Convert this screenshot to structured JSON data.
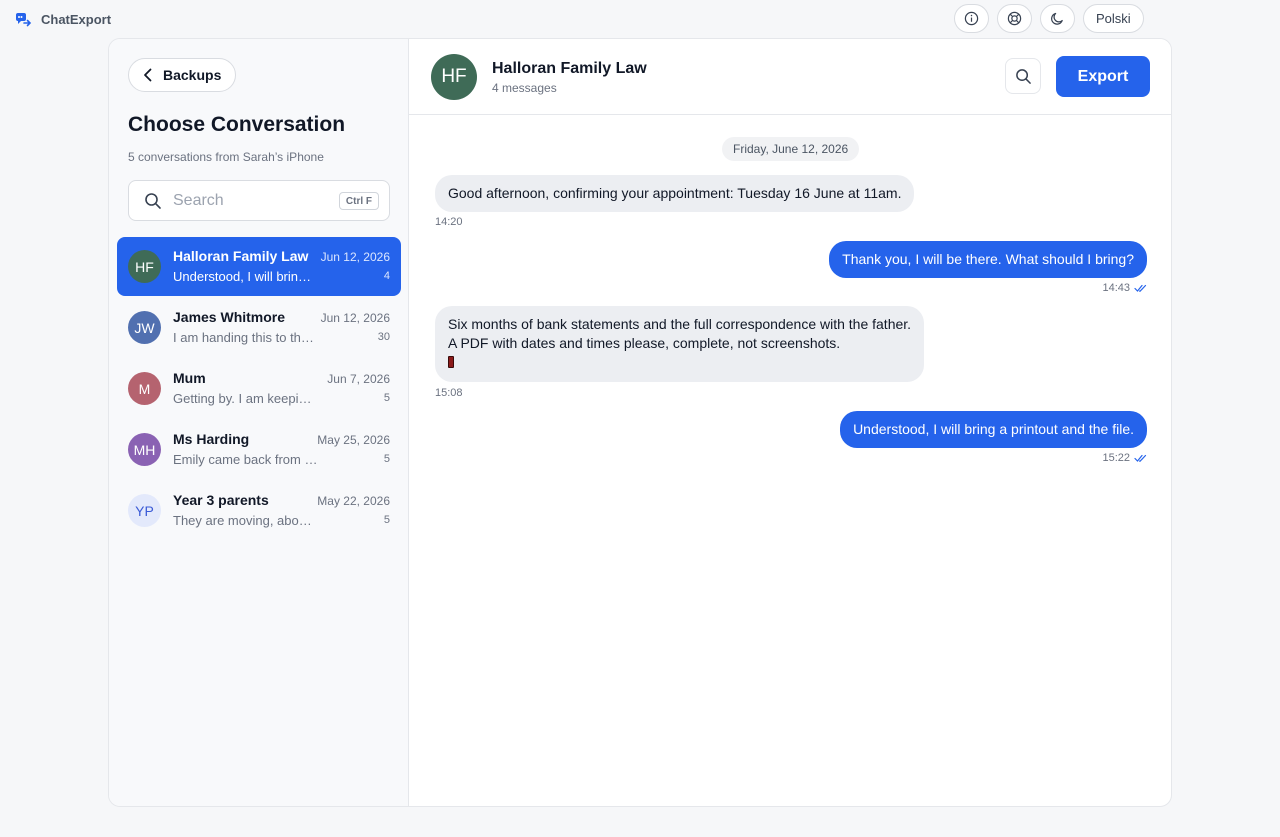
{
  "app": {
    "name": "ChatExport",
    "language_label": "Polski"
  },
  "sidebar": {
    "back_label": "Backups",
    "title": "Choose Conversation",
    "subtitle": "5 conversations from Sarah’s iPhone",
    "search_placeholder": "Search",
    "search_shortcut": "Ctrl F",
    "conversations": [
      {
        "initials": "HF",
        "name": "Halloran Family Law",
        "date": "Jun 12, 2026",
        "preview": "Understood, I will bring a printout and the file.",
        "count": "4",
        "color": "#3f6b57",
        "active": true
      },
      {
        "initials": "JW",
        "name": "James Whitmore",
        "date": "Jun 12, 2026",
        "preview": "I am handing this to the solicitor now.",
        "count": "30",
        "color": "#5170b0",
        "active": false
      },
      {
        "initials": "M",
        "name": "Mum",
        "date": "Jun 7, 2026",
        "preview": "Getting by. I am keeping busy with the garden.",
        "count": "5",
        "color": "#b5636f",
        "active": false
      },
      {
        "initials": "MH",
        "name": "Ms Harding",
        "date": "May 25, 2026",
        "preview": "Emily came back from the trip very happy.",
        "count": "5",
        "color": "#8a62b3",
        "active": false
      },
      {
        "initials": "YP",
        "name": "Year 3 parents",
        "date": "May 22, 2026",
        "preview": "They are moving, about the school fair.",
        "count": "5",
        "color": "#e3e9fb",
        "text_color": "#3b5bd6",
        "active": false
      }
    ]
  },
  "chat": {
    "contact_initials": "HF",
    "contact_name": "Halloran Family Law",
    "message_count": "4 messages",
    "export_label": "Export",
    "date_separator": "Friday, June 12, 2026",
    "messages": [
      {
        "direction": "in",
        "lines": [
          "Good afternoon, confirming your appointment: Tuesday 16 June at 11am."
        ],
        "time": "14:20"
      },
      {
        "direction": "out",
        "lines": [
          "Thank you, I will be there. What should I bring?"
        ],
        "time": "14:43",
        "read": true
      },
      {
        "direction": "in",
        "lines": [
          "Six months of bank statements and the full correspondence with the father.",
          "A PDF with dates and times please, complete, not screenshots."
        ],
        "time": "15:08",
        "attachment": true
      },
      {
        "direction": "out",
        "lines": [
          "Understood, I will bring a printout and the file."
        ],
        "time": "15:22",
        "read": true
      }
    ]
  },
  "colors": {
    "accent": "#2563eb",
    "incoming_bubble": "#eceef2"
  }
}
